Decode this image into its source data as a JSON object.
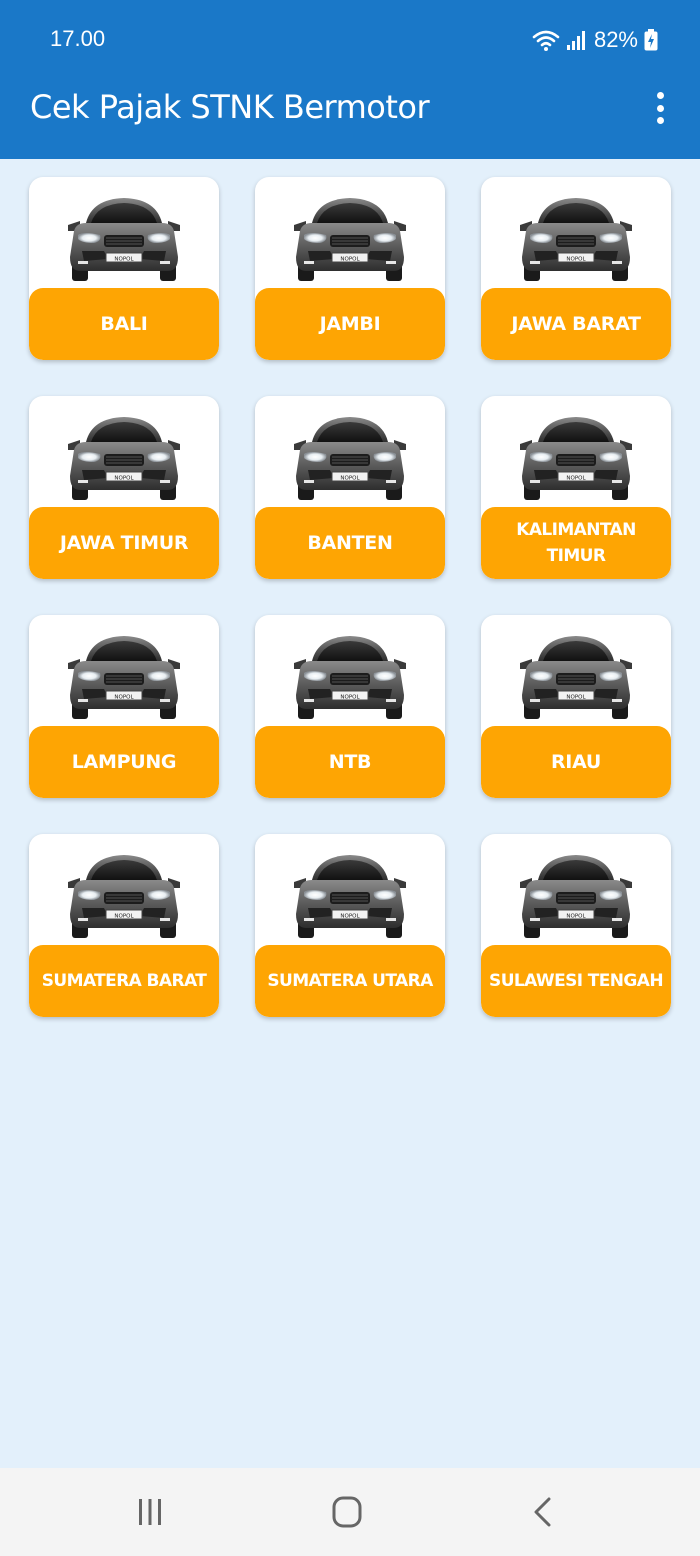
{
  "status_bar": {
    "time": "17.00",
    "battery": "82%",
    "icons": [
      "wifi-icon",
      "signal-icon",
      "battery-charging-icon"
    ]
  },
  "app_bar": {
    "title": "Cek Pajak STNK Bermotor",
    "menu_icon": "more-vert-icon"
  },
  "provinces": [
    {
      "label": "BALI"
    },
    {
      "label": "JAMBI"
    },
    {
      "label": "JAWA BARAT"
    },
    {
      "label": "JAWA TIMUR"
    },
    {
      "label": "BANTEN"
    },
    {
      "label": "KALIMANTAN TIMUR"
    },
    {
      "label": "LAMPUNG"
    },
    {
      "label": "NTB"
    },
    {
      "label": "RIAU"
    },
    {
      "label": "SUMATERA BARAT"
    },
    {
      "label": "SUMATERA UTARA"
    },
    {
      "label": "SULAWESI TENGAH"
    }
  ],
  "car_plate": "NOPOL",
  "colors": {
    "app_bar": "#1a78c8",
    "background": "#e3f0fb",
    "card_label": "#fea503"
  },
  "nav_bar": {
    "icons": [
      "recent-apps-icon",
      "home-icon",
      "back-icon"
    ]
  }
}
